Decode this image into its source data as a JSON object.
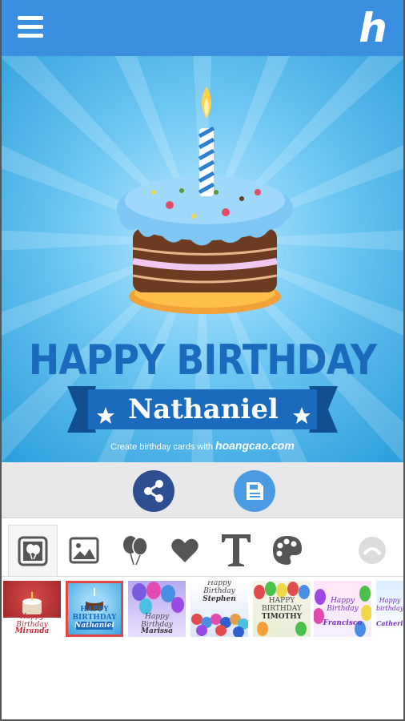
{
  "header": {
    "menu_icon": "hamburger-menu-icon",
    "logo_text": "h"
  },
  "card": {
    "headline": "HAPPY BIRTHDAY",
    "name": "Nathaniel",
    "credit_prefix": "Create birthday cards with",
    "credit_brand": "hoangcao.com",
    "colors": {
      "headline": "#1a6bbd",
      "ribbon": "#1a6bbd",
      "background": "#5bbff0"
    }
  },
  "actions": {
    "share_icon": "share-icon",
    "save_icon": "save-icon",
    "share_color": "#2d4e90",
    "save_color": "#4a9be3"
  },
  "tabs": [
    {
      "icon": "balloon-frame-icon",
      "active": true
    },
    {
      "icon": "image-icon",
      "active": false
    },
    {
      "icon": "balloons-icon",
      "active": false
    },
    {
      "icon": "heart-icon",
      "active": false
    },
    {
      "icon": "text-icon",
      "label": "T",
      "active": false
    },
    {
      "icon": "palette-icon",
      "active": false
    },
    {
      "icon": "scroll-up-icon",
      "active": false
    }
  ],
  "templates": [
    {
      "line1": "Happy Birthday",
      "line2": "Miranda",
      "selected": false
    },
    {
      "line1": "HAPPY BIRTHDAY",
      "line2": "Nathaniel",
      "selected": true
    },
    {
      "line1": "Happy Birthday",
      "line2": "Marissa",
      "selected": false
    },
    {
      "line1": "Happy Birthday",
      "line2": "Stephen",
      "selected": false
    },
    {
      "line1": "HAPPY BIRTHDAY",
      "line2": "TIMOTHY",
      "selected": false
    },
    {
      "line1": "Happy Birthday",
      "line2": "Francisco",
      "selected": false
    },
    {
      "line1": "Happy birthday",
      "line2": "Catherine",
      "selected": false
    }
  ]
}
